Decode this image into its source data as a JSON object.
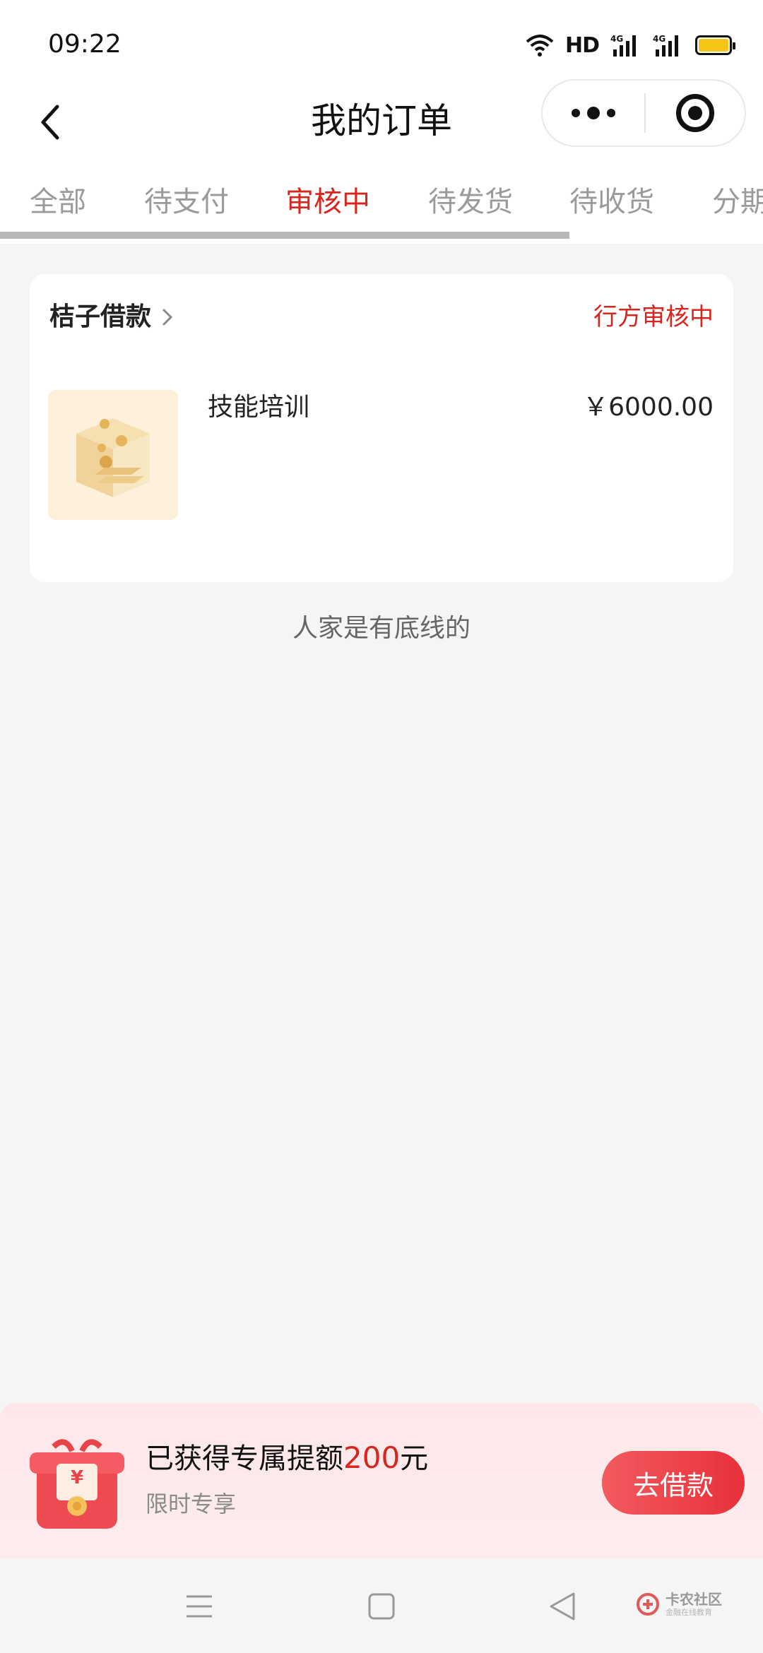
{
  "status_bar": {
    "time": "09:22",
    "network_label": "HD",
    "signal_1": "4G",
    "signal_2": "4G",
    "battery_color": "#f5c518"
  },
  "nav": {
    "title": "我的订单",
    "back_icon": "chevron-left-icon",
    "menu_icon": "more-dots-icon",
    "close_icon": "target-icon"
  },
  "tabs": [
    {
      "label": "全部",
      "active": false
    },
    {
      "label": "待支付",
      "active": false
    },
    {
      "label": "审核中",
      "active": true
    },
    {
      "label": "待发货",
      "active": false
    },
    {
      "label": "待收货",
      "active": false
    },
    {
      "label": "分期",
      "active": false
    }
  ],
  "order": {
    "shop_name": "桔子借款",
    "status": "行方审核中",
    "product_name": "技能培训",
    "price": "￥6000.00"
  },
  "footer_note": "人家是有底线的",
  "promo": {
    "title_prefix": "已获得专属提额",
    "amount": "200",
    "title_suffix": "元",
    "subtitle": "限时专享",
    "button_label": "去借款",
    "gift_symbol": "¥"
  },
  "watermark": {
    "main": "卡农社区",
    "sub": "金融在线教育"
  },
  "colors": {
    "accent": "#d7261e",
    "tab_inactive": "#9a9a9a",
    "promo_bg": "#fde7e9",
    "button_gradient_start": "#f25b5e",
    "button_gradient_end": "#e8303a"
  }
}
